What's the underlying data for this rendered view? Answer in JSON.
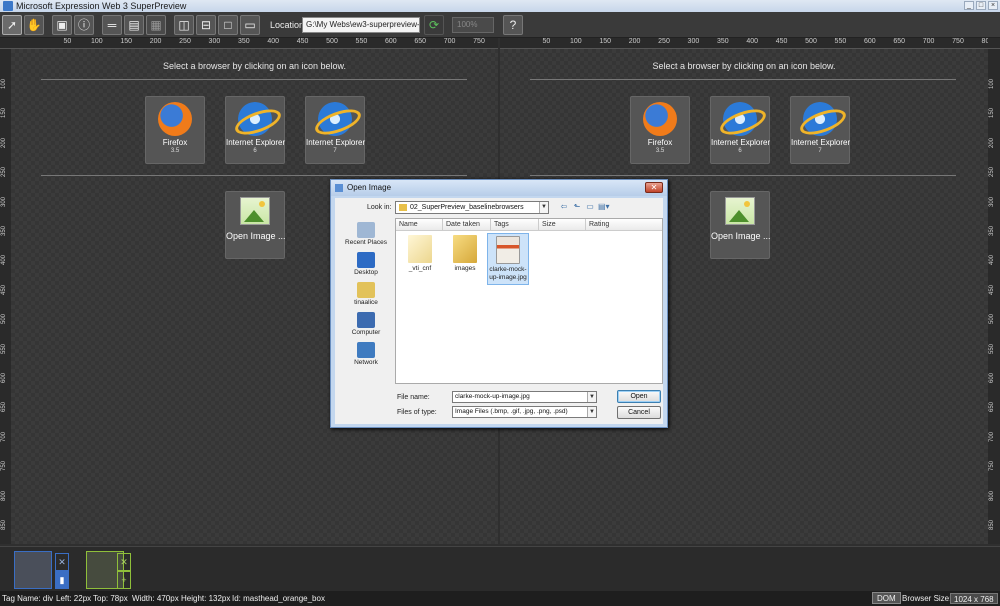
{
  "window": {
    "title": "Microsoft Expression Web 3 SuperPreview"
  },
  "toolbar": {
    "location_label": "Location:",
    "location_value": "G:\\My Webs\\ew3-superpreview-exar",
    "zoom_value": "100%"
  },
  "ruler": {
    "h_labels": [
      "50",
      "100",
      "150",
      "200",
      "250",
      "300",
      "350",
      "400",
      "450",
      "500",
      "550",
      "600",
      "650",
      "700",
      "750",
      "800"
    ],
    "v_labels": [
      "100",
      "150",
      "200",
      "250",
      "300",
      "350",
      "400",
      "450",
      "500",
      "550",
      "600",
      "650",
      "700",
      "750",
      "800",
      "850"
    ]
  },
  "panes": [
    {
      "hint": "Select a browser by clicking on an icon below.",
      "browsers": [
        {
          "name": "Firefox",
          "version": "3.5",
          "icon": "firefox-icon"
        },
        {
          "name": "Internet Explorer",
          "version": "6",
          "icon": "ie-icon"
        },
        {
          "name": "Internet Explorer",
          "version": "7",
          "icon": "ie-icon"
        }
      ],
      "open_image_label": "Open Image ..."
    },
    {
      "hint": "Select a browser by clicking on an icon below.",
      "browsers": [
        {
          "name": "Firefox",
          "version": "3.5",
          "icon": "firefox-icon"
        },
        {
          "name": "Internet Explorer",
          "version": "6",
          "icon": "ie-icon"
        },
        {
          "name": "Internet Explorer",
          "version": "7",
          "icon": "ie-icon"
        }
      ],
      "open_image_label": "Open Image ..."
    }
  ],
  "dialog": {
    "title": "Open Image",
    "look_in_label": "Look in:",
    "look_in_value": "02_SuperPreview_baselinebrowsers",
    "places": [
      "Recent Places",
      "Desktop",
      "tinaalice",
      "Computer",
      "Network"
    ],
    "columns": [
      "Name",
      "Date taken",
      "Tags",
      "Size",
      "Rating"
    ],
    "files": [
      {
        "name": "_vti_cnf",
        "type": "folder-hidden"
      },
      {
        "name": "images",
        "type": "folder"
      },
      {
        "name": "clarke-mock-up-image.jpg",
        "type": "image",
        "selected": true
      }
    ],
    "file_name_label": "File name:",
    "file_name_value": "clarke-mock-up-image.jpg",
    "files_of_type_label": "Files of type:",
    "files_of_type_value": "Image Files (.bmp, .gif, .jpg, .png, .psd)",
    "open_label": "Open",
    "cancel_label": "Cancel"
  },
  "status": {
    "tag_name": "Tag Name: div",
    "left": "Left: 22px",
    "top": "Top: 78px",
    "width": "Width: 470px",
    "height": "Height: 132px",
    "id": "Id: masthead_orange_box",
    "dom_label": "DOM",
    "browser_size_label": "Browser Size:",
    "browser_size_value": "1024 x 768"
  },
  "colors": {
    "accent_green": "#8fbf3a",
    "snap_blue": "#3a6ec4",
    "pane_bg": "#3b3b3b"
  }
}
